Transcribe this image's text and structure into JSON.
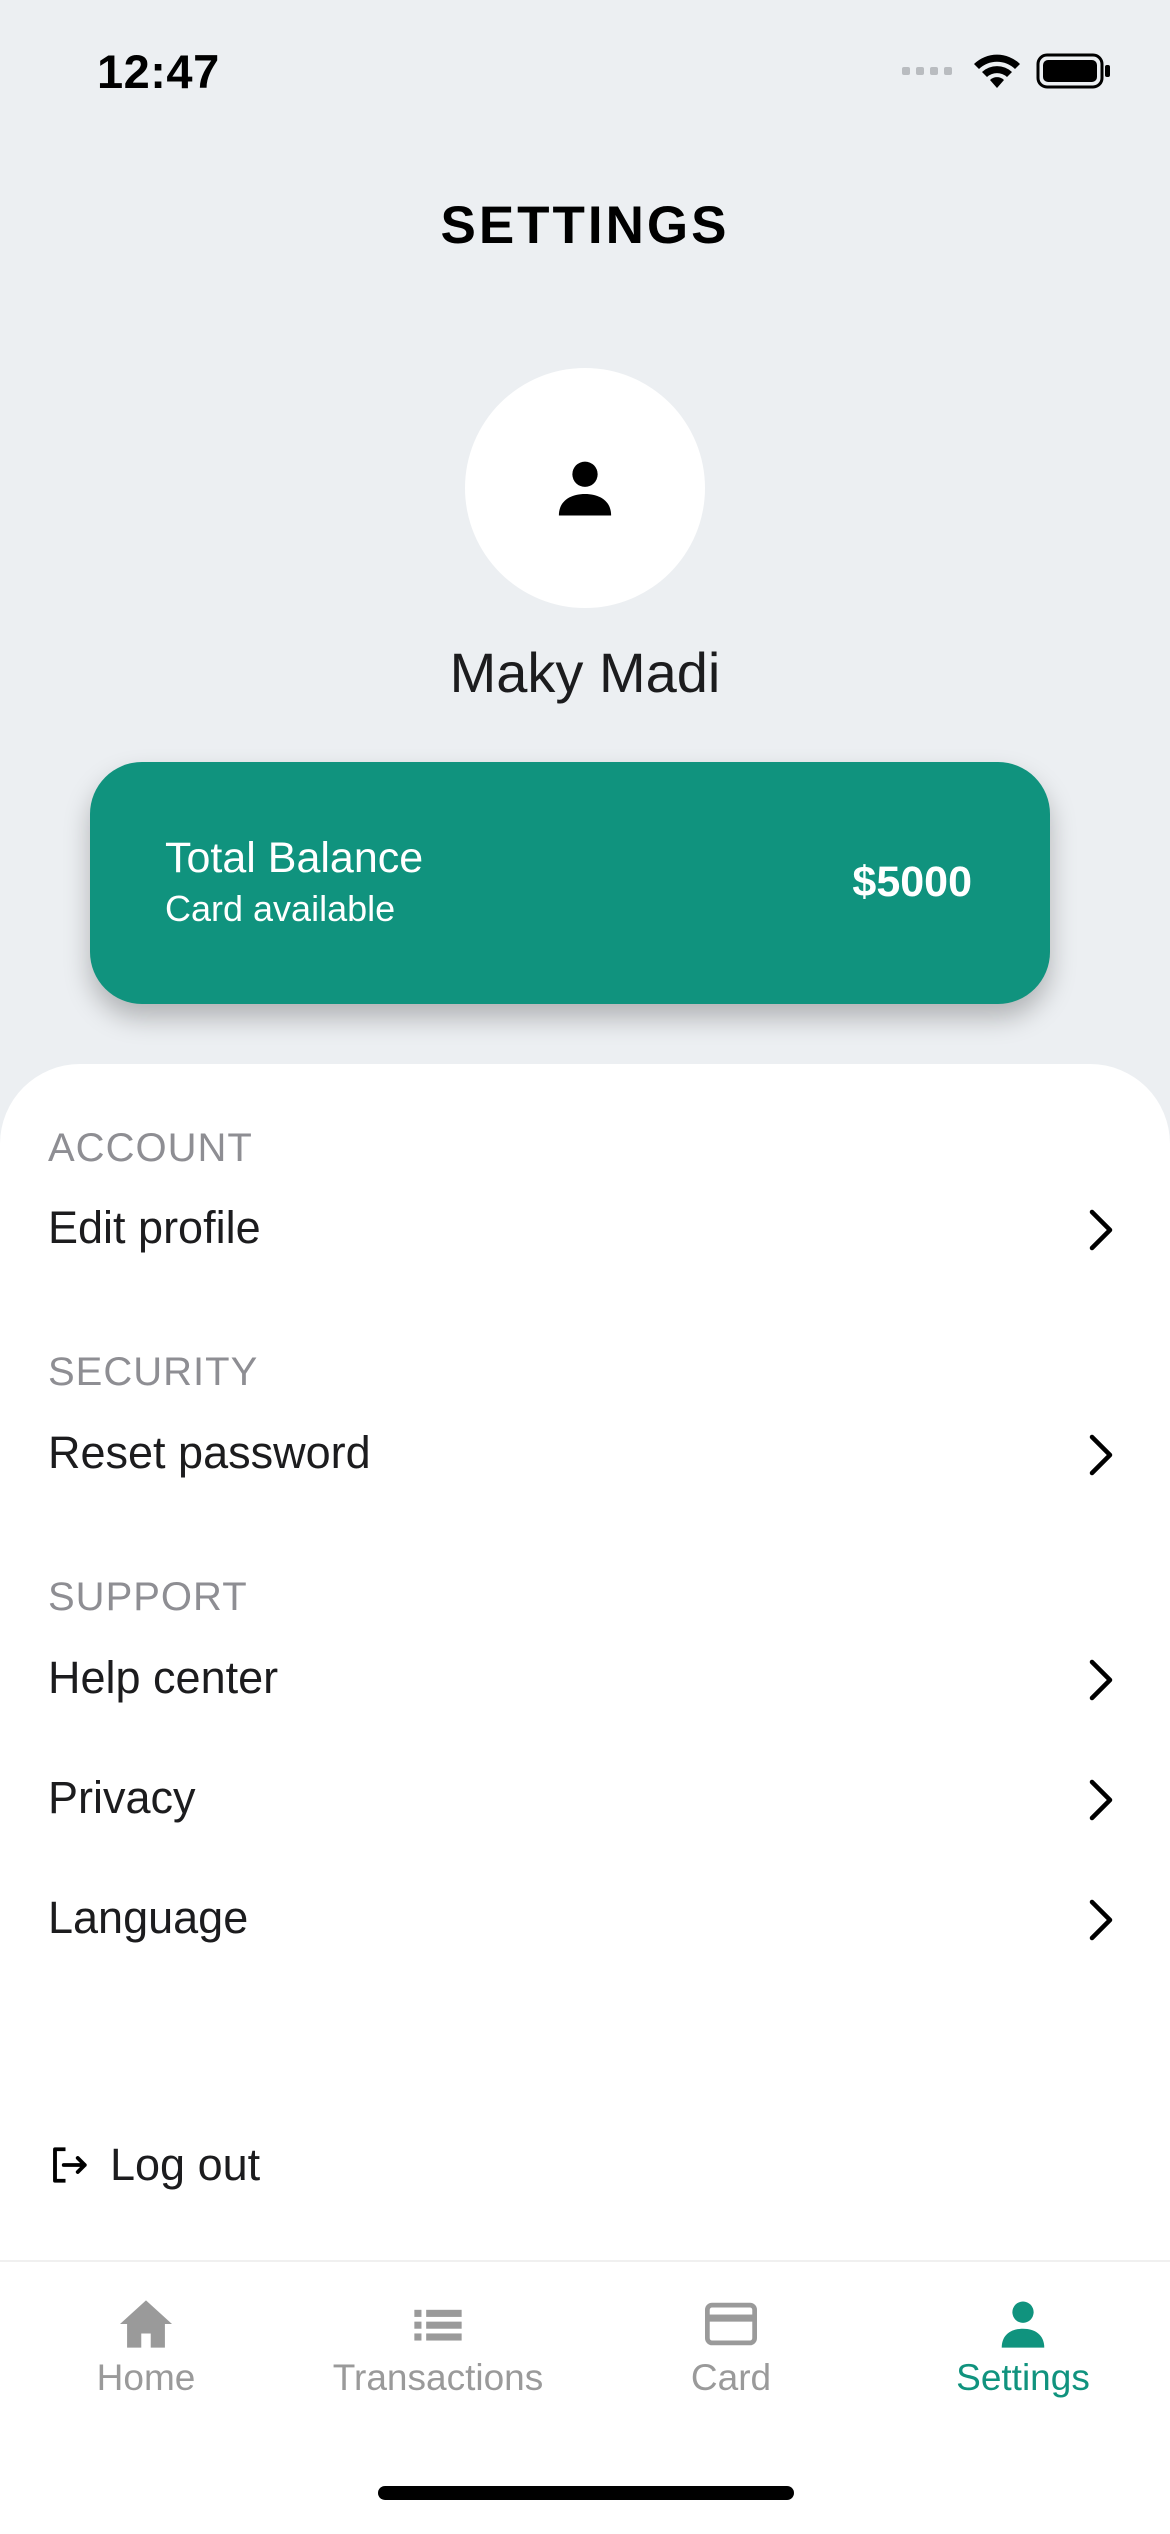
{
  "status_bar": {
    "time": "12:47"
  },
  "header": {
    "title": "SETTINGS"
  },
  "profile": {
    "name": "Maky Madi",
    "avatar_icon": "person-icon"
  },
  "balance_card": {
    "title": "Total Balance",
    "subtitle": "Card available",
    "amount": "$5000",
    "color": "#10937e"
  },
  "sections": {
    "account": {
      "label": "ACCOUNT",
      "items": [
        {
          "label": "Edit profile"
        }
      ]
    },
    "security": {
      "label": "SECURITY",
      "items": [
        {
          "label": "Reset password"
        }
      ]
    },
    "support": {
      "label": "SUPPORT",
      "items": [
        {
          "label": "Help center"
        },
        {
          "label": "Privacy"
        },
        {
          "label": "Language"
        }
      ]
    }
  },
  "logout": {
    "label": "Log out",
    "icon": "logout-icon"
  },
  "tab_bar": {
    "active": "Settings",
    "active_color": "#10937e",
    "tabs": [
      {
        "label": "Home",
        "icon": "home-icon"
      },
      {
        "label": "Transactions",
        "icon": "list-icon"
      },
      {
        "label": "Card",
        "icon": "credit-card-icon"
      },
      {
        "label": "Settings",
        "icon": "person-icon"
      }
    ]
  }
}
